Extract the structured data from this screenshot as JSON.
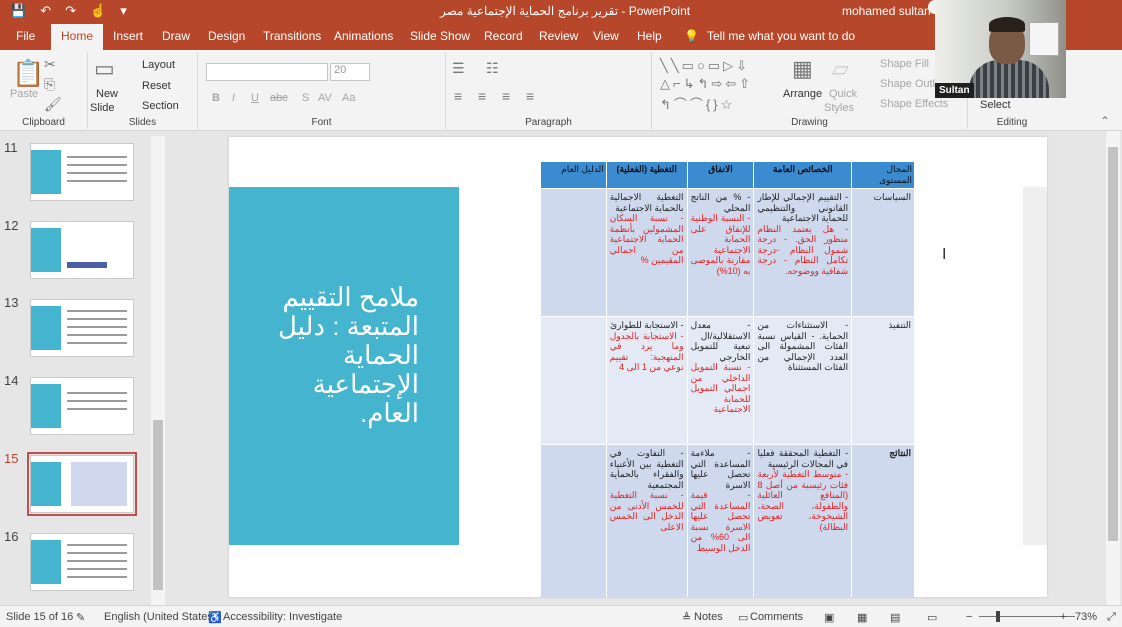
{
  "titlebar": {
    "title": "تقرير برنامج الحماية الإجتماعية مصر  -  PowerPoint",
    "user": "mohamed sultan"
  },
  "qat": {
    "save_icon": "💾",
    "undo_icon": "↶",
    "redo_icon": "↷",
    "touch_icon": "☝",
    "customize_icon": "▾"
  },
  "tabs": [
    "File",
    "Home",
    "Insert",
    "Draw",
    "Design",
    "Transitions",
    "Animations",
    "Slide Show",
    "Record",
    "Review",
    "View",
    "Help"
  ],
  "tell_me": "Tell me what you want to do",
  "ribbon": {
    "clipboard": {
      "paste": "Paste",
      "label": "Clipboard"
    },
    "slides": {
      "new_slide": "New",
      "new_slide2": "Slide",
      "layout": "Layout",
      "reset": "Reset",
      "section": "Section",
      "label": "Slides"
    },
    "font": {
      "size": "20",
      "label": "Font",
      "bold": "B",
      "italic": "I",
      "underline": "U",
      "strike": "abc",
      "shadow": "S",
      "spacing": "AV",
      "case": "Aa"
    },
    "paragraph": {
      "label": "Paragraph"
    },
    "drawing": {
      "arrange": "Arrange",
      "quick": "Quick",
      "styles": "Styles",
      "fill": "Shape Fill",
      "outline": "Shape Outline",
      "effects": "Shape Effects",
      "label": "Drawing"
    },
    "editing": {
      "select": "Select",
      "label": "Editing"
    }
  },
  "slides_pane": {
    "numbers": [
      "11",
      "12",
      "13",
      "14",
      "15",
      "16"
    ]
  },
  "slide": {
    "title": "ملامح التقييم المتبعة : دليل الحماية الإجتماعية العام.",
    "table": {
      "headers": [
        "المجال المستوى",
        "الخصائص العامة",
        "الانفاق",
        "التغطية (الفعلية)",
        "الدليل العام"
      ],
      "rows": [
        {
          "label": "السياسات",
          "c1": "- التقييم الإجمالي للإطار القانوني والتنظيمي للحماية الاجتماعية",
          "c1r": "- هل يعتمد النظام منظور الحق. - درجة شمول النظام -درجة تكامل النظام - درجة شفافية ووضوحه.",
          "c2": "- % من الناتج المحلي",
          "c2r": "- النسبة الوطنية للإنفاق على الحماية الاجتماعية مقارنة بالموصى به (10%)",
          "c3": "التغطية الاجمالية بالحماية الاجتماعية",
          "c3r": "- نسبة السكان المشمولين بأنظمة الحماية الاجتماعية من اجمالي المقيمين %"
        },
        {
          "label": "التنفيذ",
          "c1": "- الاستثناءات من الحماية. - القياس نسبة الفئات المشمولة الى العدد الإجمالي من الفئات المستثناة",
          "c1r": "",
          "c2": "- معدل الاستقلالية/ال تبعية للتمويل الخارجي",
          "c2r": "- نسبة التمويل الداخلي من اجمالي التمويل للحماية الاجتماعية",
          "c3": "- الاستجابة للطوارئ",
          "c3r": "- الاستجابة بالجدول وما يرد في المنهجية: تقييم نوعي من 1 الى 4"
        },
        {
          "label": "النتائج",
          "c1": "- التغطية المحققة فعليا في المجالات الرئيسية",
          "c1r": "- متوسط التغطية لأربعة فئات رئيسية من أصل 8 (المنافع العائلية والطفولة، الصحة، الشيخوخة، تعويض البطالة)",
          "c2": "- ملاءمة المساعدة التي تحصل عليها الاسرة",
          "c2r": "- قيمة المساعدة التي تحصل عليها الاسرة نسبة الى 60% من الدخل الوسيط",
          "c3": "- التفاوت في التغطية بين الأغنياء والفقراء بالحماية المجتمعية",
          "c3r": "- نسبة التغطية للخمس الأدنى من الدخل الى الخمس الاعلى"
        }
      ]
    }
  },
  "webcam": {
    "name": "Sultan"
  },
  "status": {
    "slide_count": "Slide 15 of 16",
    "language": "English (United States)",
    "accessibility": "Accessibility: Investigate",
    "notes": "Notes",
    "comments": "Comments",
    "zoom": "73%"
  }
}
